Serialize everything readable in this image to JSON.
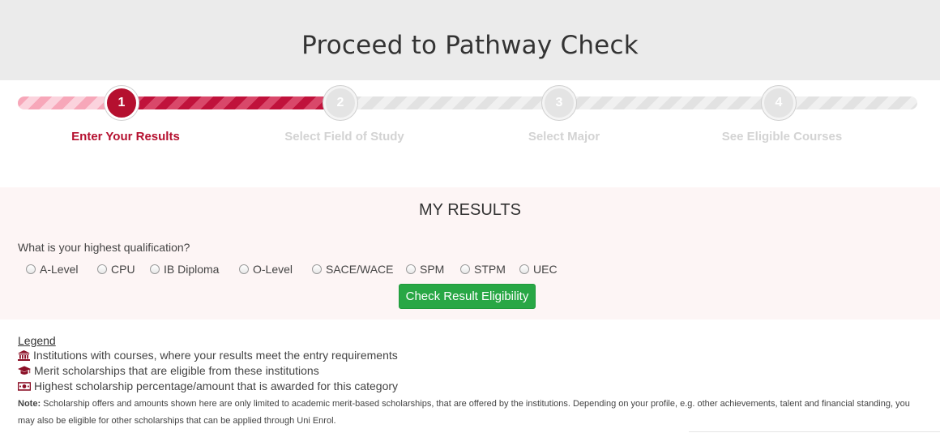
{
  "page": {
    "title": "Proceed to Pathway Check"
  },
  "steps": [
    {
      "number": "1",
      "label": "Enter Your Results",
      "state": "active"
    },
    {
      "number": "2",
      "label": "Select Field of Study",
      "state": "pending"
    },
    {
      "number": "3",
      "label": "Select Major",
      "state": "pending"
    },
    {
      "number": "4",
      "label": "See Eligible Courses",
      "state": "pending"
    }
  ],
  "results": {
    "heading": "MY RESULTS",
    "question": "What is your highest qualification?",
    "options": [
      "A-Level",
      "CPU",
      "IB Diploma",
      "O-Level",
      "SACE/WACE",
      "SPM",
      "STPM",
      "UEC"
    ],
    "selected_option": null,
    "submit_label": "Check Result Eligibility"
  },
  "legend": {
    "title": "Legend",
    "items": [
      {
        "icon": "institution-icon",
        "text": "Institutions with courses, where your results meet the entry requirements"
      },
      {
        "icon": "graduation-cap-icon",
        "text": "Merit scholarships that are eligible from these institutions"
      },
      {
        "icon": "money-bill-icon",
        "text": "Highest scholarship percentage/amount that is awarded for this category"
      }
    ],
    "note_label": "Note:",
    "note_text": "Scholarship offers and amounts shown here are only limited to academic merit-based scholarships, that are offered by the institutions. Depending on your profile, e.g. other achievements, talent and financial standing, you may also be eligible for other scholarships that can be applied through Uni Enrol."
  },
  "colors": {
    "accent": "#b5102f",
    "button": "#28a745",
    "header_bg": "#ebebeb",
    "results_bg": "#fdf5f5",
    "pending": "#d3d3d3"
  }
}
